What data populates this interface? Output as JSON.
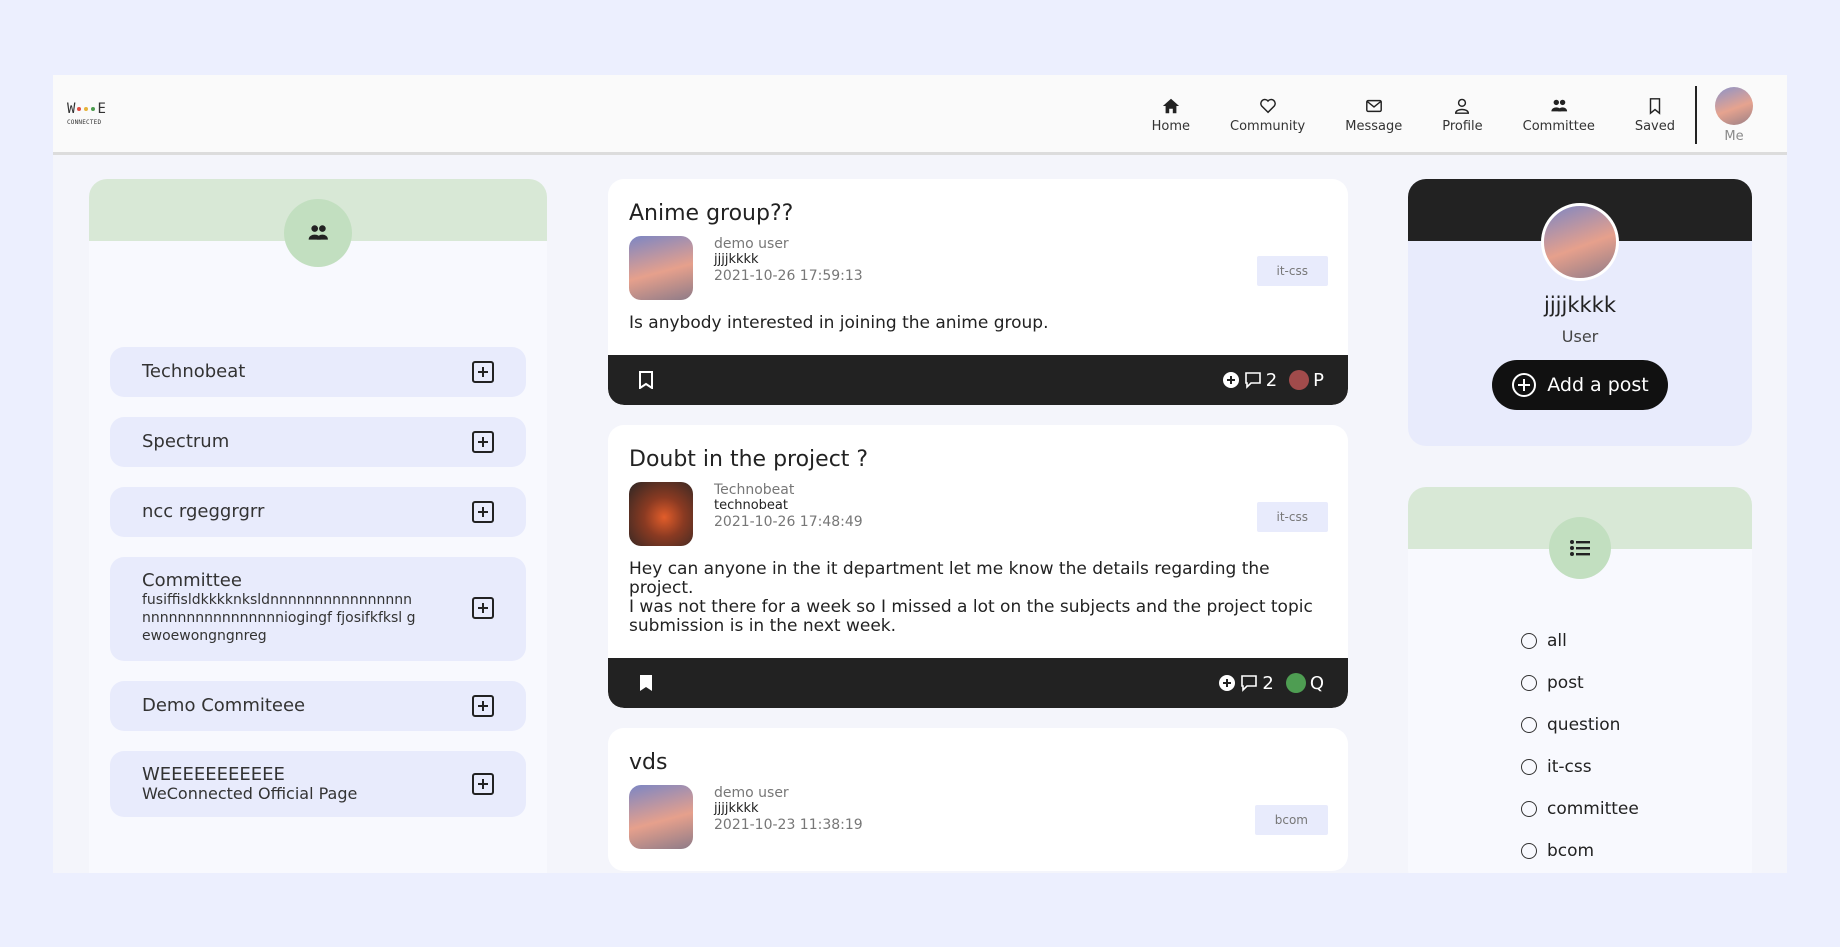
{
  "logo": {
    "mark": "WeeeE",
    "sub": "CONNECTED"
  },
  "nav": {
    "items": [
      {
        "label": "Home",
        "icon": "home-icon"
      },
      {
        "label": "Community",
        "icon": "heart-icon"
      },
      {
        "label": "Message",
        "icon": "mail-icon"
      },
      {
        "label": "Profile",
        "icon": "user-icon"
      },
      {
        "label": "Committee",
        "icon": "users-icon"
      },
      {
        "label": "Saved",
        "icon": "bookmark-icon"
      }
    ],
    "me_label": "Me"
  },
  "committees": [
    {
      "name": "Technobeat",
      "desc": ""
    },
    {
      "name": "Spectrum",
      "desc": ""
    },
    {
      "name": "ncc rgeggrgrr",
      "desc": ""
    },
    {
      "name": "Committee",
      "desc": "fusiffisldkkkknksldnnnnnnnnnnnnnnnn nnnnnnnnnnnnnnnniogingf fjosifkfksl gewoewongngnreg"
    },
    {
      "name": "Demo Commiteee",
      "desc": ""
    },
    {
      "name": "WEEEEEEEEEEE",
      "desc": "WeConnected Official Page"
    }
  ],
  "posts": [
    {
      "title": "Anime group??",
      "community": "demo user",
      "user": "jjjjkkkk",
      "date": "2021-10-26 17:59:13",
      "tag": "it-css",
      "body": "Is anybody interested in joining the anime group.",
      "comments": "2",
      "type_letter": "P",
      "type_color": "#a14b4b"
    },
    {
      "title": "Doubt in the project ?",
      "community": "Technobeat",
      "user": "technobeat",
      "date": "2021-10-26 17:48:49",
      "tag": "it-css",
      "body": "Hey can anyone in the it department let me know the details regarding the project.\nI was not there for a week so I missed a lot on the subjects and the project topic submission is in the next week.",
      "comments": "2",
      "type_letter": "Q",
      "type_color": "#4e9d52"
    },
    {
      "title": "vds",
      "community": "demo user",
      "user": "jjjjkkkk",
      "date": "2021-10-23 11:38:19",
      "tag": "bcom",
      "body": "",
      "comments": "",
      "type_letter": "",
      "type_color": ""
    }
  ],
  "profile": {
    "username": "jjjjkkkk",
    "role": "User",
    "add_post_label": "Add a post"
  },
  "filters": {
    "options": [
      "all",
      "post",
      "question",
      "it-css",
      "committee",
      "bcom"
    ]
  },
  "colors": {
    "page_bg": "#eceffe",
    "green_band": "#d8e8d6",
    "dark_bar": "#222222",
    "card_tint": "#e8ebfc"
  }
}
